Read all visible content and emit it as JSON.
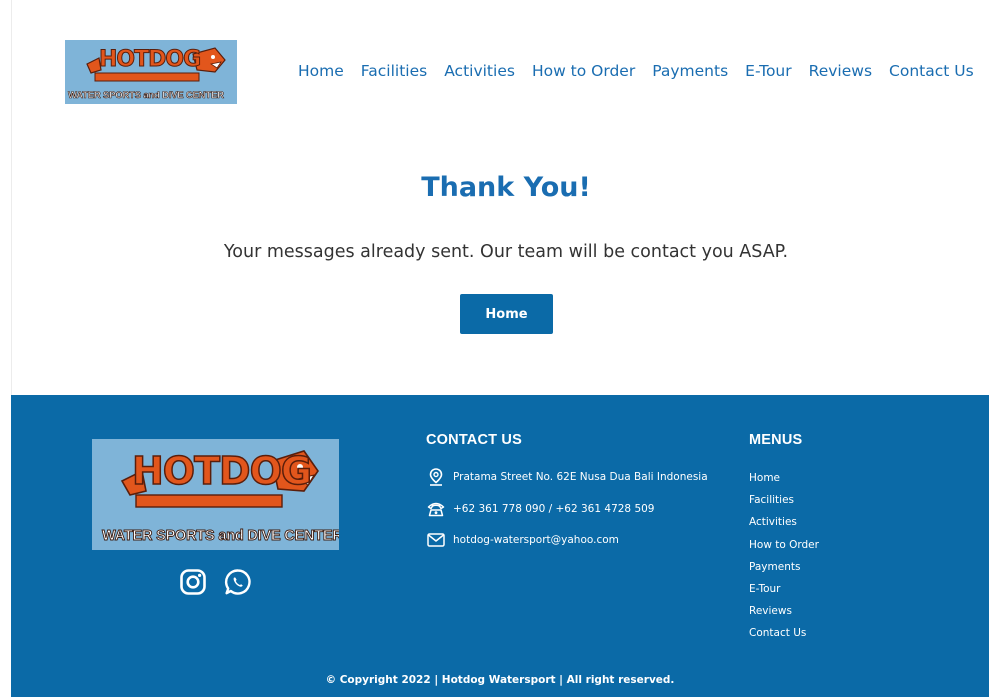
{
  "header": {
    "logo": {
      "title": "HOTDOG",
      "subtitle": "WATER SPORTS and DIVE CENTER"
    },
    "nav": [
      {
        "label": "Home"
      },
      {
        "label": "Facilities"
      },
      {
        "label": "Activities"
      },
      {
        "label": "How to Order"
      },
      {
        "label": "Payments"
      },
      {
        "label": "E-Tour"
      },
      {
        "label": "Reviews"
      },
      {
        "label": "Contact Us"
      }
    ]
  },
  "main": {
    "title": "Thank You!",
    "message": "Your messages already sent. Our team will be contact you ASAP.",
    "button_label": "Home"
  },
  "footer": {
    "logo": {
      "title": "HOTDOG",
      "subtitle": "WATER SPORTS and DIVE CENTER"
    },
    "social": [
      {
        "icon": "instagram-icon"
      },
      {
        "icon": "whatsapp-icon"
      }
    ],
    "contact": {
      "heading": "CONTACT US",
      "address": "Pratama Street No. 62E Nusa Dua Bali Indonesia",
      "phone": "+62 361 778 090 / +62 361 4728 509",
      "email": "hotdog-watersport@yahoo.com"
    },
    "menus": {
      "heading": "MENUS",
      "items": [
        "Home",
        "Facilities",
        "Activities",
        "How to Order",
        "Payments",
        "E-Tour",
        "Reviews",
        "Contact Us"
      ]
    },
    "copyright": "© Copyright 2022 | Hotdog Watersport | All right reserved."
  },
  "colors": {
    "brand_blue": "#1a6db1",
    "footer_bg": "#0b6aa7",
    "logo_bg": "#7fb4d8",
    "logo_orange": "#e2561c"
  }
}
